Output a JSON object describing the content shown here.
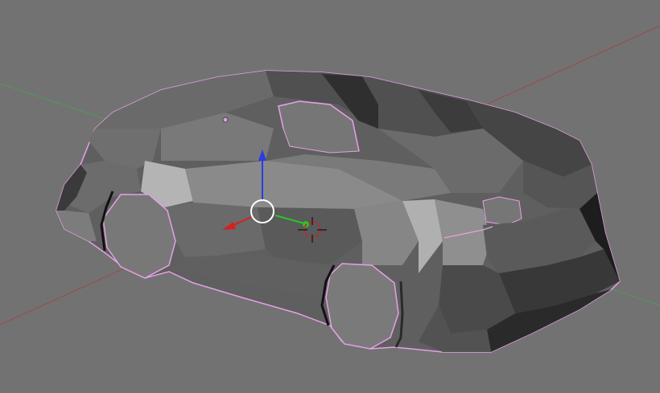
{
  "viewport": {
    "name": "3d-viewport",
    "background": "#727272"
  },
  "colors": {
    "grid_x_axis": "#9a4a4a",
    "grid_y_axis": "#4f9a4f",
    "selection_outline": "#e6a0e6",
    "gizmo_x": "#d81f1f",
    "gizmo_y": "#27c527",
    "gizmo_z": "#2b3de0",
    "gizmo_center": "#ffffff",
    "cursor_ring": "#d22222",
    "cursor_cross": "#111111"
  },
  "scene": {
    "object": "car-mesh",
    "shading": "solid",
    "selected": true
  },
  "icons": {
    "transform_gizmo": "move-gizmo-icon",
    "cursor": "3d-cursor-icon",
    "origin": "object-origin-icon"
  }
}
